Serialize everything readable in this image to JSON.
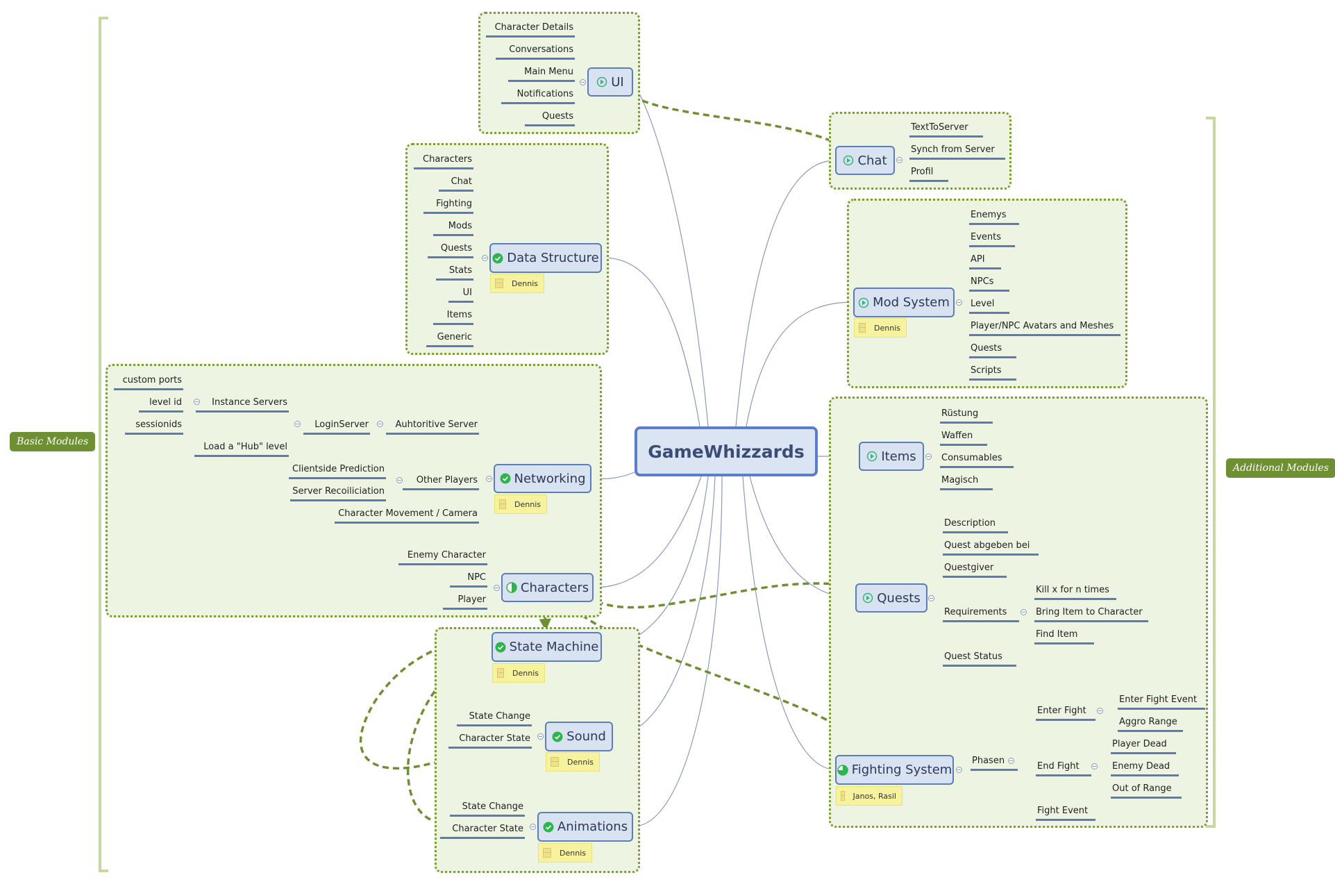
{
  "central": {
    "label": "GameWhizzards"
  },
  "boundaries": {
    "left": "Basic Modules",
    "right": "Additional Modules"
  },
  "icons": {
    "play": "play-circle-icon",
    "done": "check-circle-icon",
    "half": "half-progress-icon",
    "three_quarter": "three-quarter-progress-icon",
    "note": "note-icon",
    "collapse": "collapse-icon"
  },
  "colors": {
    "group_fill": "#edf5e2",
    "group_border": "#7d9a3c",
    "node_fill": "#d9e2f1",
    "node_border": "#5b7dbb",
    "leaf_underline": "#5b7bb5",
    "relationship": "#6f8f33",
    "note_fill": "#f6f29e",
    "boundary_label": "#6f8f33"
  },
  "modules": {
    "ui": {
      "label": "UI",
      "status": "play",
      "children": [
        "Character Details",
        "Conversations",
        "Main Menu",
        "Notifications",
        "Quests"
      ]
    },
    "data_structure": {
      "label": "Data Structure",
      "status": "done",
      "assignee": "Dennis",
      "children": [
        "Characters",
        "Chat",
        "Fighting",
        "Mods",
        "Quests",
        "Stats",
        "UI",
        "Items",
        "Generic"
      ]
    },
    "networking": {
      "label": "Networking",
      "status": "done",
      "assignee": "Dennis",
      "authoritive": "Auhtoritive Server",
      "login": "LoginServer",
      "instance": "Instance Servers",
      "instance_children": [
        "custom ports",
        "level id",
        "sessionids"
      ],
      "hub": "Load a \"Hub\" level",
      "other_players": "Other Players",
      "other_children": [
        "Clientside Prediction",
        "Server Recoiliciation"
      ],
      "movement": "Character Movement / Camera"
    },
    "characters": {
      "label": "Characters",
      "status": "half",
      "children": [
        "Enemy Character",
        "NPC",
        "Player"
      ]
    },
    "state_machine": {
      "label": "State Machine",
      "status": "done",
      "assignee": "Dennis"
    },
    "sound": {
      "label": "Sound",
      "status": "done",
      "assignee": "Dennis",
      "children": [
        "State Change",
        "Character State"
      ]
    },
    "animations": {
      "label": "Animations",
      "status": "done",
      "assignee": "Dennis",
      "children": [
        "State Change",
        "Character State"
      ]
    },
    "chat": {
      "label": "Chat",
      "status": "play",
      "children": [
        "TextToServer",
        "Synch from Server",
        "Profil"
      ]
    },
    "mod_system": {
      "label": "Mod System",
      "status": "play",
      "assignee": "Dennis",
      "children": [
        "Enemys",
        "Events",
        "API",
        "NPCs",
        "Level",
        "Player/NPC Avatars and Meshes",
        "Quests",
        "Scripts"
      ]
    },
    "items": {
      "label": "Items",
      "status": "play",
      "children": [
        "Rüstung",
        "Waffen",
        "Consumables",
        "Magisch"
      ]
    },
    "quests": {
      "label": "Quests",
      "status": "play",
      "children": [
        "Description",
        "Quest abgeben bei",
        "Questgiver",
        "Requirements",
        "Quest Status"
      ],
      "requirements_children": [
        "Kill x for n times",
        "Bring Item to Character",
        "Find Item"
      ]
    },
    "fighting": {
      "label": "Fighting System",
      "status": "three_quarter",
      "assignee": "Janos, Rasil",
      "phasen": "Phasen",
      "enter": "Enter Fight",
      "enter_children": [
        "Enter Fight Event",
        "Aggro Range"
      ],
      "end": "End Fight",
      "end_children": [
        "Player Dead",
        "Enemy Dead",
        "Out of Range"
      ],
      "event": "Fight Event"
    }
  }
}
